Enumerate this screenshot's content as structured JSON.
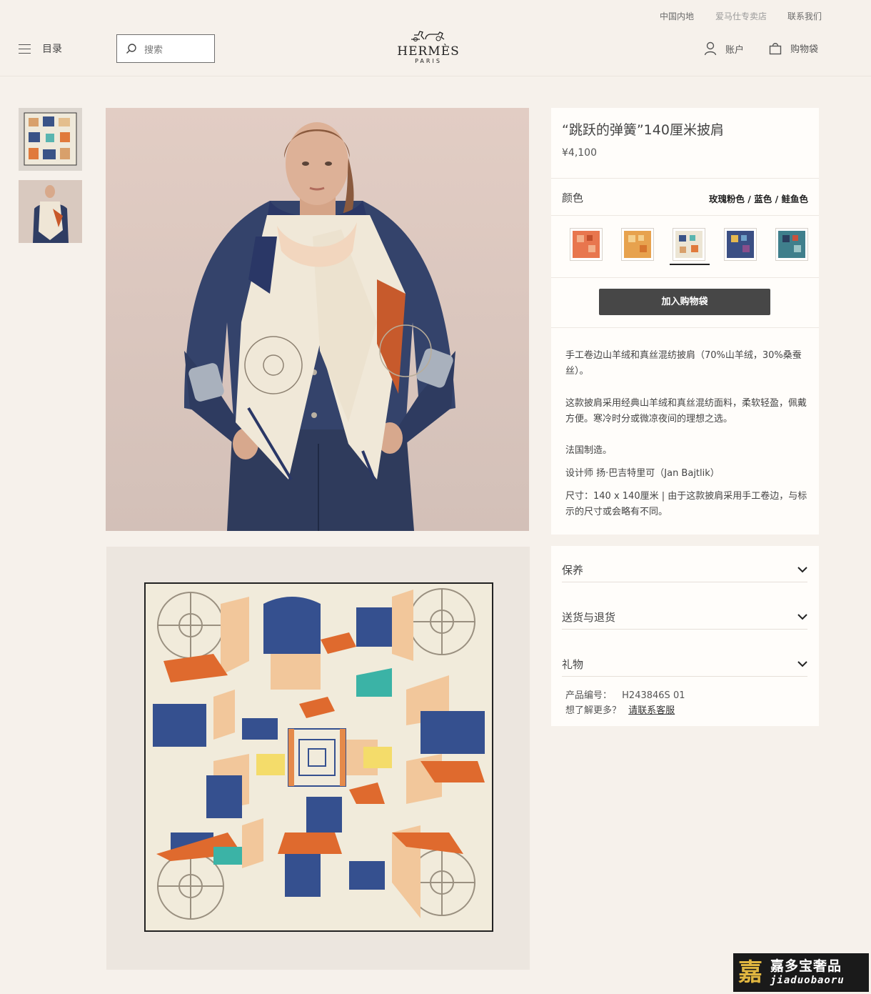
{
  "header": {
    "utility_links": [
      "中国内地",
      "爱马仕专卖店",
      "联系我们"
    ],
    "menu_label": "目录",
    "search_placeholder": "搜索",
    "logo_word": "HERMÈS",
    "logo_city": "PARIS",
    "account_label": "账户",
    "bag_label": "购物袋"
  },
  "product": {
    "name": "“跳跃的弹簧”140厘米披肩",
    "price": "¥4,100",
    "color_label": "颜色",
    "color_value": "玫瑰粉色 / 蓝色 / 鲑鱼色",
    "swatches": [
      {
        "name": "coral",
        "color": "#e8764e"
      },
      {
        "name": "orange",
        "color": "#e7a24e"
      },
      {
        "name": "cream",
        "color": "#e9e3d3"
      },
      {
        "name": "navy",
        "color": "#3b4f84"
      },
      {
        "name": "teal",
        "color": "#3f7f8c"
      }
    ],
    "selected_swatch": 2,
    "add_to_bag": "加入购物袋",
    "description": [
      "手工卷边山羊绒和真丝混纺披肩（70%山羊绒，30%桑蚕丝）。",
      "这款披肩采用经典山羊绒和真丝混纺面料，柔软轻盈，佩戴方便。寒冷时分或微凉夜间的理想之选。",
      "法国制造。",
      "设计师 扬·巴吉特里可（Jan Bajtlik）",
      "尺寸：140 x 140厘米 | 由于这款披肩采用手工卷边，与标示的尺寸或会略有不同。"
    ]
  },
  "accordion": [
    {
      "label": "保养"
    },
    {
      "label": "送货与退货"
    },
    {
      "label": "礼物"
    }
  ],
  "meta": {
    "product_code_label": "产品编号：",
    "product_code": "H243846S 01",
    "more_info_label": "想了解更多？",
    "contact_link": "请联系客服"
  },
  "watermark": {
    "seal": "嘉",
    "cn": "嘉多宝奢品",
    "en": "jiaduobaoru"
  },
  "colors": {
    "background": "#f6f1eb",
    "panel": "#fffdfa",
    "button": "#474747"
  }
}
